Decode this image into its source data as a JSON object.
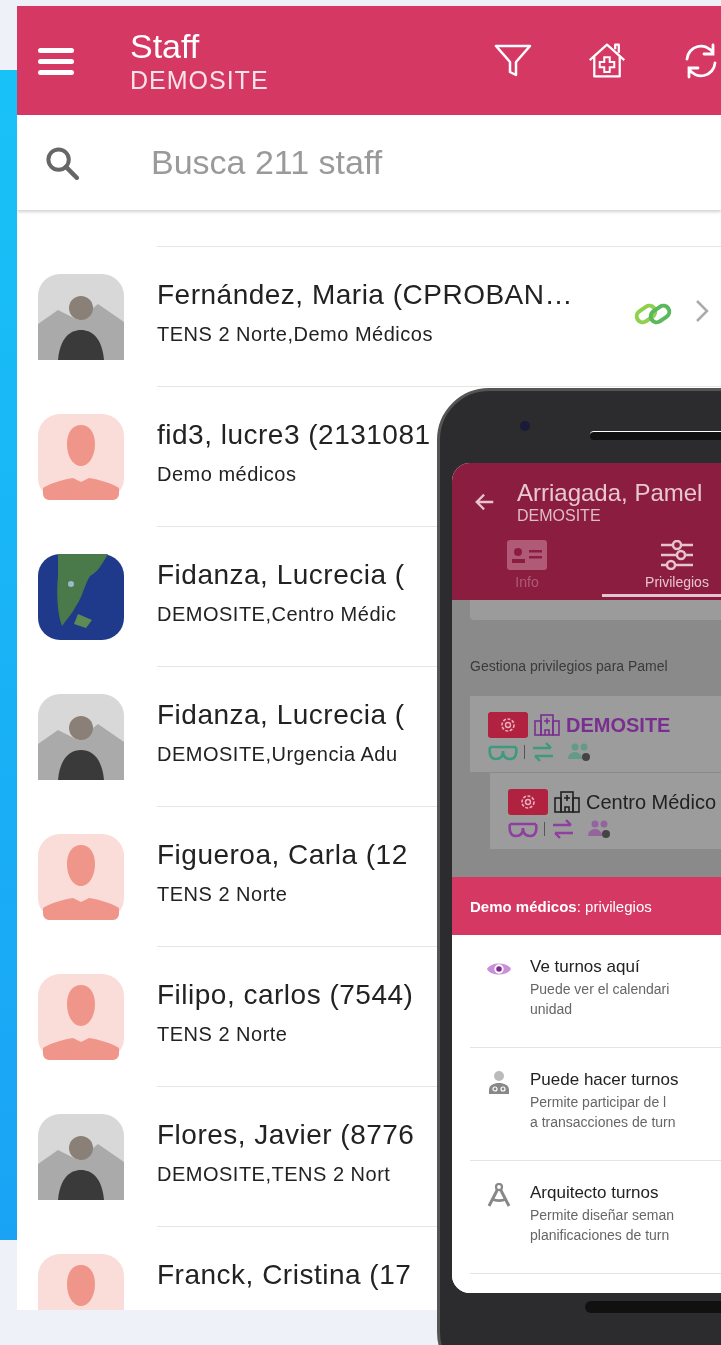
{
  "header": {
    "title": "Staff",
    "subtitle": "DEMOSITE"
  },
  "search": {
    "placeholder": "Busca 211 staff"
  },
  "staff": [
    {
      "name": "Fernández, Maria (CPROBAN…",
      "units": "TENS 2 Norte,Demo Médicos",
      "kind": "picture",
      "linked": true
    },
    {
      "name": "fid3, lucre3 (2131081",
      "units": "Demo médicos",
      "kind": "placeholder"
    },
    {
      "name": "Fidanza, Lucrecia (",
      "units": "DEMOSITE,Centro Médic",
      "kind": "picture"
    },
    {
      "name": "Fidanza, Lucrecia (",
      "units": "DEMOSITE,Urgencia Adu",
      "kind": "picture"
    },
    {
      "name": "Figueroa, Carla (12",
      "units": "TENS 2 Norte",
      "kind": "placeholder"
    },
    {
      "name": "Filipo, carlos (7544)",
      "units": "TENS 2 Norte",
      "kind": "placeholder"
    },
    {
      "name": "Flores, Javier (8776",
      "units": "DEMOSITE,TENS 2 Nort",
      "kind": "picture"
    },
    {
      "name": "Franck, Cristina (17",
      "kind": "placeholder"
    }
  ],
  "phone": {
    "title": "Arriagada, Pamel",
    "subtitle": "DEMOSITE",
    "tabs": [
      {
        "label": "Info",
        "selected": false
      },
      {
        "label": "Privilegios",
        "selected": true
      }
    ],
    "intro": "Gestiona privilegios para Pamel",
    "units": [
      {
        "kind": "site",
        "title": "DEMOSITE",
        "color": "#3d9a7e"
      },
      {
        "kind": "unit",
        "title": "Centro Médico",
        "color": "#8e3fa0"
      }
    ],
    "sheet": {
      "heading": "**Demo médicos**: privilegios",
      "items": [
        {
          "kind": "eye",
          "title": "Ve turnos aquí",
          "lines": [
            "Puede ver el calendari",
            "unidad"
          ]
        },
        {
          "kind": "doctor",
          "title": "Puede hacer turnos",
          "lines": [
            "Permite participar de l",
            "a transacciones de turn"
          ]
        },
        {
          "kind": "compass",
          "title": "Arquitecto turnos",
          "lines": [
            "Permite diseñar seman",
            "planificaciones de turn"
          ]
        }
      ]
    }
  }
}
